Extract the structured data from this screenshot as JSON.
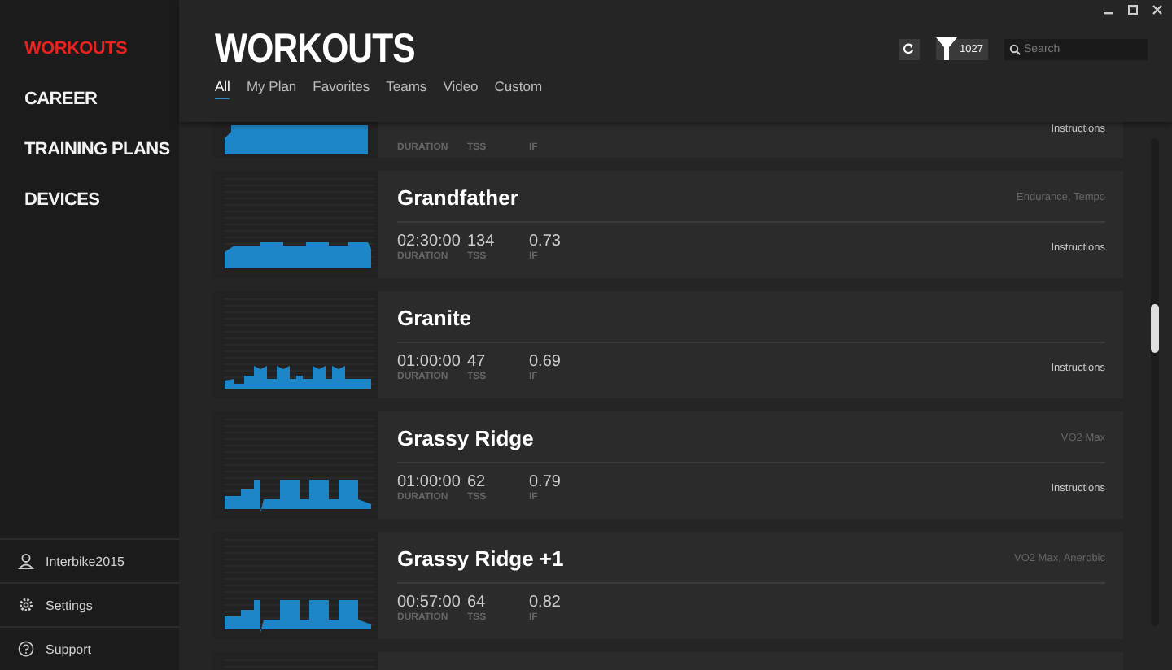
{
  "sidebar": {
    "items": [
      {
        "label": "WORKOUTS",
        "selected": true
      },
      {
        "label": "CAREER",
        "selected": false
      },
      {
        "label": "TRAINING PLANS",
        "selected": false
      },
      {
        "label": "DEVICES",
        "selected": false
      }
    ],
    "footer": [
      {
        "kind": "user",
        "label": "Interbike2015"
      },
      {
        "kind": "settings",
        "label": "Settings"
      },
      {
        "kind": "support",
        "label": "Support"
      }
    ]
  },
  "header": {
    "title": "WORKOUTS",
    "filter_count": "1027",
    "search": {
      "placeholder": "Search"
    }
  },
  "tabs": [
    {
      "label": "All",
      "selected": true
    },
    {
      "label": "My Plan",
      "selected": false
    },
    {
      "label": "Favorites",
      "selected": false
    },
    {
      "label": "Teams",
      "selected": false
    },
    {
      "label": "Video",
      "selected": false
    },
    {
      "label": "Custom",
      "selected": false
    }
  ],
  "partial_top": {
    "kind": "dense",
    "labels": [
      "DURATION",
      "TSS",
      "IF"
    ],
    "link": "Instructions"
  },
  "workouts": [
    {
      "kind": "steady",
      "name": "Grandfather",
      "tags": "Endurance, Tempo",
      "duration": "02:30:00",
      "duration_label": "DURATION",
      "tss": "134",
      "tss_label": "TSS",
      "if": "0.73",
      "if_label": "IF",
      "link": "Instructions"
    },
    {
      "kind": "blocks",
      "name": "Granite",
      "duration": "01:00:00",
      "duration_label": "DURATION",
      "tss": "47",
      "tss_label": "TSS",
      "if": "0.69",
      "if_label": "IF",
      "link": "Instructions"
    },
    {
      "kind": "intervals",
      "name": "Grassy Ridge",
      "tags": "VO2 Max",
      "duration": "01:00:00",
      "duration_label": "DURATION",
      "tss": "62",
      "tss_label": "TSS",
      "if": "0.79",
      "if_label": "IF",
      "link": "Instructions"
    },
    {
      "kind": "intervals",
      "name": "Grassy Ridge +1",
      "tags": "VO2 Max, Anerobic",
      "duration": "00:57:00",
      "duration_label": "DURATION",
      "tss": "64",
      "tss_label": "TSS",
      "if": "0.82",
      "if_label": "IF"
    }
  ],
  "partial_bottom": {
    "kind": "empty"
  }
}
